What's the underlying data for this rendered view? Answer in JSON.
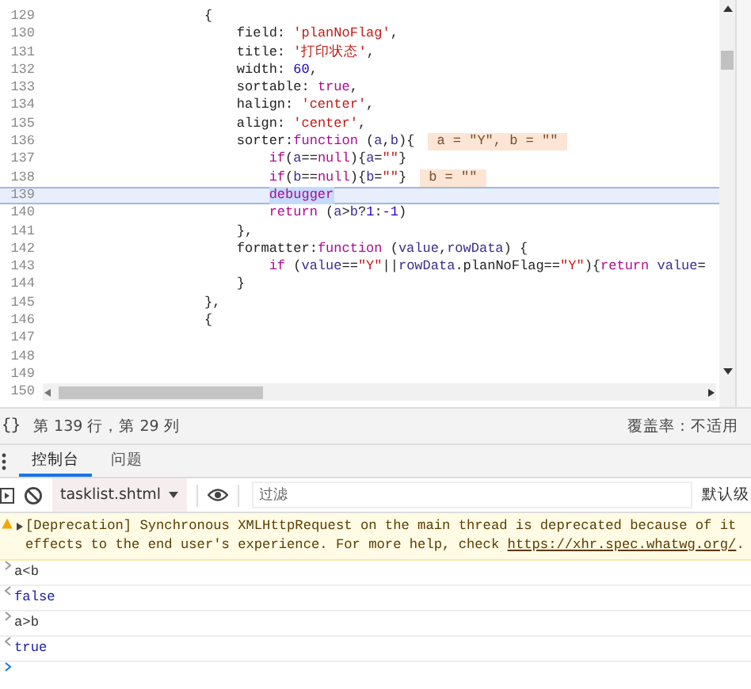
{
  "editor": {
    "lines": [
      {
        "number": "129",
        "current": false,
        "tokens": [
          {
            "kind": "plain",
            "text": "                    {"
          }
        ]
      },
      {
        "number": "130",
        "current": false,
        "tokens": [
          {
            "kind": "plain",
            "text": "                        field: "
          },
          {
            "kind": "string",
            "text": "'planNoFlag'"
          },
          {
            "kind": "plain",
            "text": ","
          }
        ]
      },
      {
        "number": "131",
        "current": false,
        "tokens": [
          {
            "kind": "plain",
            "text": "                        title: "
          },
          {
            "kind": "string",
            "text": "'打印状态'"
          },
          {
            "kind": "plain",
            "text": ","
          }
        ]
      },
      {
        "number": "132",
        "current": false,
        "tokens": [
          {
            "kind": "plain",
            "text": "                        width: "
          },
          {
            "kind": "number",
            "text": "60"
          },
          {
            "kind": "plain",
            "text": ","
          }
        ]
      },
      {
        "number": "133",
        "current": false,
        "tokens": [
          {
            "kind": "plain",
            "text": "                        sortable: "
          },
          {
            "kind": "keyword",
            "text": "true"
          },
          {
            "kind": "plain",
            "text": ","
          }
        ]
      },
      {
        "number": "134",
        "current": false,
        "tokens": [
          {
            "kind": "plain",
            "text": "                        halign: "
          },
          {
            "kind": "string",
            "text": "'center'"
          },
          {
            "kind": "plain",
            "text": ","
          }
        ]
      },
      {
        "number": "135",
        "current": false,
        "tokens": [
          {
            "kind": "plain",
            "text": "                        align: "
          },
          {
            "kind": "string",
            "text": "'center'"
          },
          {
            "kind": "plain",
            "text": ","
          }
        ]
      },
      {
        "number": "136",
        "current": false,
        "tokens": [
          {
            "kind": "plain",
            "text": "                        sorter:"
          },
          {
            "kind": "keyword",
            "text": "function"
          },
          {
            "kind": "plain",
            "text": " ("
          },
          {
            "kind": "variable",
            "text": "a"
          },
          {
            "kind": "plain",
            "text": ","
          },
          {
            "kind": "variable",
            "text": "b"
          },
          {
            "kind": "plain",
            "text": "){"
          }
        ],
        "annotation": "a = \"Y\", b = \"\""
      },
      {
        "number": "137",
        "current": false,
        "tokens": [
          {
            "kind": "keyword",
            "text": "                            if"
          },
          {
            "kind": "plain",
            "text": "("
          },
          {
            "kind": "variable",
            "text": "a"
          },
          {
            "kind": "plain",
            "text": "=="
          },
          {
            "kind": "keyword",
            "text": "null"
          },
          {
            "kind": "plain",
            "text": "){"
          },
          {
            "kind": "variable",
            "text": "a"
          },
          {
            "kind": "plain",
            "text": "="
          },
          {
            "kind": "string",
            "text": "\"\""
          },
          {
            "kind": "plain",
            "text": "}"
          }
        ]
      },
      {
        "number": "138",
        "current": false,
        "tokens": [
          {
            "kind": "keyword",
            "text": "                            if"
          },
          {
            "kind": "plain",
            "text": "("
          },
          {
            "kind": "variable",
            "text": "b"
          },
          {
            "kind": "plain",
            "text": "=="
          },
          {
            "kind": "keyword",
            "text": "null"
          },
          {
            "kind": "plain",
            "text": "){"
          },
          {
            "kind": "variable",
            "text": "b"
          },
          {
            "kind": "plain",
            "text": "="
          },
          {
            "kind": "string",
            "text": "\"\""
          },
          {
            "kind": "plain",
            "text": "}"
          }
        ],
        "annotation": "b = \"\""
      },
      {
        "number": "139",
        "current": true,
        "tokens": [
          {
            "kind": "keyword",
            "text": "                            debugger"
          }
        ]
      },
      {
        "number": "140",
        "current": false,
        "tokens": [
          {
            "kind": "keyword",
            "text": "                            return"
          },
          {
            "kind": "plain",
            "text": " ("
          },
          {
            "kind": "variable",
            "text": "a"
          },
          {
            "kind": "plain",
            "text": ">"
          },
          {
            "kind": "variable",
            "text": "b"
          },
          {
            "kind": "plain",
            "text": "?"
          },
          {
            "kind": "number",
            "text": "1"
          },
          {
            "kind": "plain",
            "text": ":"
          },
          {
            "kind": "number",
            "text": "-1"
          },
          {
            "kind": "plain",
            "text": ")"
          }
        ]
      },
      {
        "number": "141",
        "current": false,
        "tokens": [
          {
            "kind": "plain",
            "text": "                        },"
          }
        ]
      },
      {
        "number": "142",
        "current": false,
        "tokens": [
          {
            "kind": "plain",
            "text": "                        formatter:"
          },
          {
            "kind": "keyword",
            "text": "function"
          },
          {
            "kind": "plain",
            "text": " ("
          },
          {
            "kind": "variable",
            "text": "value"
          },
          {
            "kind": "plain",
            "text": ","
          },
          {
            "kind": "variable",
            "text": "rowData"
          },
          {
            "kind": "plain",
            "text": ") {"
          }
        ]
      },
      {
        "number": "143",
        "current": false,
        "tokens": [
          {
            "kind": "keyword",
            "text": "                            if"
          },
          {
            "kind": "plain",
            "text": " ("
          },
          {
            "kind": "variable",
            "text": "value"
          },
          {
            "kind": "plain",
            "text": "=="
          },
          {
            "kind": "string",
            "text": "\"Y\""
          },
          {
            "kind": "plain",
            "text": "||"
          },
          {
            "kind": "variable",
            "text": "rowData"
          },
          {
            "kind": "plain",
            "text": ".planNoFlag=="
          },
          {
            "kind": "string",
            "text": "\"Y\""
          },
          {
            "kind": "plain",
            "text": "){"
          },
          {
            "kind": "keyword",
            "text": "return "
          },
          {
            "kind": "variable",
            "text": "value"
          },
          {
            "kind": "plain",
            "text": "="
          }
        ]
      },
      {
        "number": "144",
        "current": false,
        "tokens": [
          {
            "kind": "plain",
            "text": "                        }"
          }
        ]
      },
      {
        "number": "145",
        "current": false,
        "tokens": [
          {
            "kind": "plain",
            "text": "                    },"
          }
        ]
      },
      {
        "number": "146",
        "current": false,
        "tokens": [
          {
            "kind": "plain",
            "text": "                    {"
          }
        ]
      },
      {
        "number": "147",
        "current": false
      },
      {
        "number": "148",
        "current": false
      },
      {
        "number": "149",
        "current": false
      }
    ],
    "scroll_row_number": "150"
  },
  "status_bar": {
    "pretty_print": "{}",
    "position": "第 139 行，第 29 列",
    "coverage": "覆盖率：不适用"
  },
  "console": {
    "tabs": [
      {
        "label": "控制台",
        "selected": true
      },
      {
        "label": "问题",
        "selected": false
      }
    ],
    "context": "tasklist.shtml",
    "filter": {
      "placeholder": "过滤"
    },
    "levels": "默认级",
    "messages": [
      {
        "kind": "warning",
        "line_1": "[Deprecation] Synchronous XMLHttpRequest on the main thread is deprecated because of it",
        "line_2": "effects to the end user's experience. For more help, check ",
        "link": "https://xhr.spec.whatwg.org/",
        "trailing": "."
      },
      {
        "kind": "input",
        "text": "a<b"
      },
      {
        "kind": "result",
        "text": "false"
      },
      {
        "kind": "input",
        "text": "a>b"
      },
      {
        "kind": "result",
        "text": "true"
      },
      {
        "kind": "prompt"
      }
    ]
  }
}
